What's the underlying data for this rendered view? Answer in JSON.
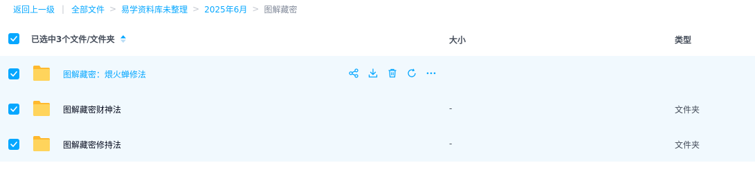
{
  "breadcrumb": {
    "back": "返回上一级",
    "items": [
      "全部文件",
      "易学资料库未整理",
      "2025年6月"
    ],
    "current": "图解藏密",
    "separator": ">",
    "divider": "|"
  },
  "header": {
    "selection_label": "已选中3个文件/文件夹",
    "size_label": "大小",
    "type_label": "类型"
  },
  "files": [
    {
      "name": "图解藏密：煨火蝉修法",
      "size": "",
      "type": ""
    },
    {
      "name": "图解藏密财神法",
      "size": "-",
      "type": "文件夹"
    },
    {
      "name": "图解藏密修持法",
      "size": "-",
      "type": "文件夹"
    }
  ],
  "actions": [
    "share-icon",
    "download-icon",
    "delete-icon",
    "refresh-icon",
    "more-icon"
  ],
  "colors": {
    "accent": "#06a7ff",
    "row_bg": "#f1f9fe",
    "folder": "#ffc83d"
  }
}
